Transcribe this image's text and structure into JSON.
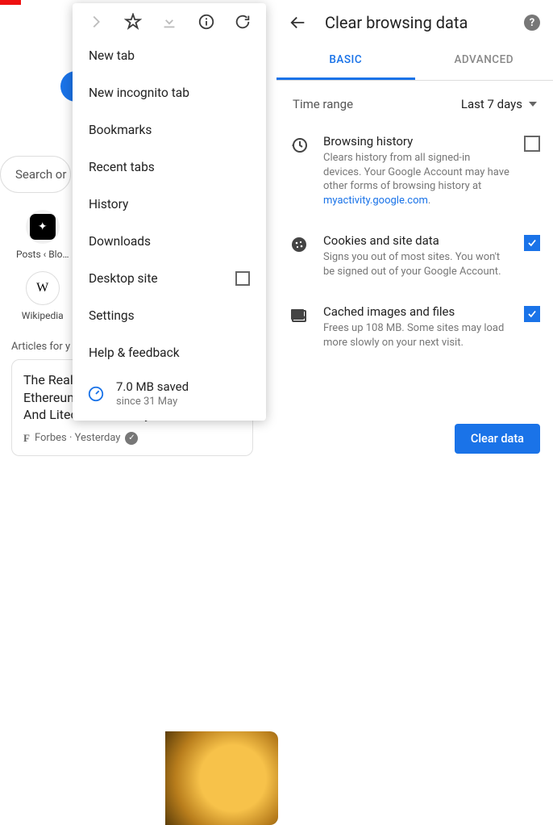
{
  "left": {
    "search_placeholder": "Search or",
    "shortcuts": [
      {
        "label": "Posts ‹ Blo…"
      },
      {
        "label": "Wikipedia"
      }
    ],
    "articles_header": "Articles for y",
    "card": {
      "title": "The Real ",
      "line2": "Ethereum,",
      "line3": "And Litecoin Suddenly …",
      "source": "Forbes · Yesterday"
    }
  },
  "menu": {
    "items": [
      "New tab",
      "New incognito tab",
      "Bookmarks",
      "Recent tabs",
      "History",
      "Downloads",
      "Desktop site",
      "Settings",
      "Help & feedback"
    ],
    "saved_amount": "7.0 MB saved",
    "saved_since": "since 31 May"
  },
  "cbd": {
    "title": "Clear browsing data",
    "tab_basic": "BASIC",
    "tab_advanced": "ADVANCED",
    "range_label": "Time range",
    "range_value": "Last 7 days",
    "items": [
      {
        "title": "Browsing history",
        "desc": "Clears history from all signed-in devices. Your Google Account may have other forms of browsing history at ",
        "link": "myactivity.google.com",
        "checked": false
      },
      {
        "title": "Cookies and site data",
        "desc": "Signs you out of most sites. You won't be signed out of your Google Account.",
        "checked": true
      },
      {
        "title": "Cached images and files",
        "desc": "Frees up 108 MB. Some sites may load more slowly on your next visit.",
        "checked": true
      }
    ],
    "clear_btn": "Clear data"
  }
}
